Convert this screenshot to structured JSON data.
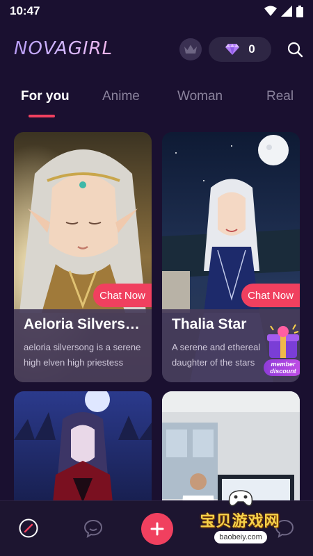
{
  "status": {
    "time": "10:47"
  },
  "header": {
    "logo": "NOVAGIRL",
    "gem_count": "0"
  },
  "tabs": [
    {
      "label": "For you",
      "active": true
    },
    {
      "label": "Anime",
      "active": false
    },
    {
      "label": "Woman",
      "active": false
    },
    {
      "label": "Real",
      "active": false
    }
  ],
  "cards": [
    {
      "name": "Aeloria Silvers…",
      "description": "aeloria silversong is a serene high elven high priestess wh…",
      "cta": "Chat Now"
    },
    {
      "name": "Thalia Star",
      "description": "A serene and ethereal daughter of the stars wh…",
      "cta": "Chat Now",
      "badge": "member discount"
    },
    {
      "name": "",
      "description": ""
    },
    {
      "name": "",
      "description": ""
    }
  ],
  "watermark": {
    "text": "宝贝游戏网",
    "url": "baobeiy.com"
  },
  "colors": {
    "accent": "#f0405f",
    "background": "#1a1030",
    "card_info": "#463c5a"
  },
  "icons": [
    "wifi-icon",
    "signal-icon",
    "battery-icon",
    "crown-icon",
    "diamond-icon",
    "search-icon",
    "compass-icon",
    "chat-bubble-icon",
    "plus-icon"
  ]
}
